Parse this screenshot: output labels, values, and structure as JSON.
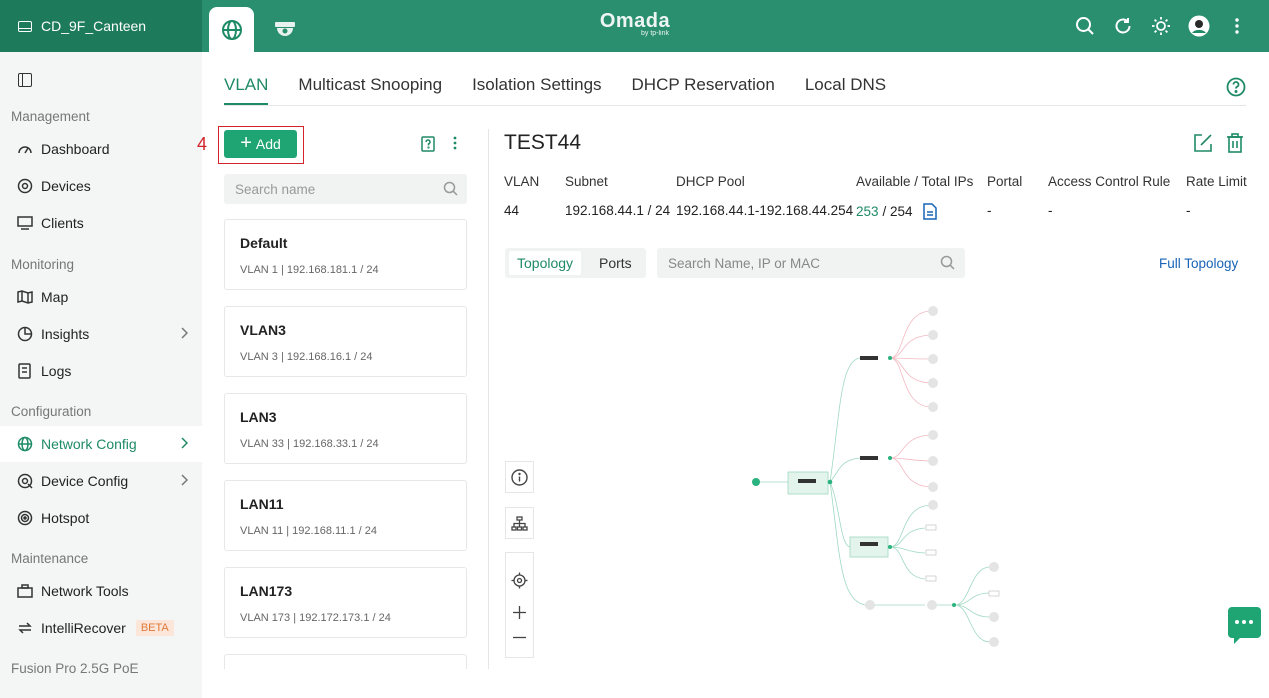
{
  "topbar": {
    "site_name": "CD_9F_Canteen",
    "logo": "Omada",
    "logo_sub": "by tp-link",
    "icons": [
      "search-icon",
      "refresh-icon",
      "theme-icon",
      "avatar",
      "more-icon"
    ]
  },
  "sidebar": {
    "sections": {
      "management": "Management",
      "monitoring": "Monitoring",
      "configuration": "Configuration",
      "maintenance": "Maintenance",
      "device_group": "Fusion Pro 2.5G PoE"
    },
    "items": {
      "dashboard": "Dashboard",
      "devices": "Devices",
      "clients": "Clients",
      "map": "Map",
      "insights": "Insights",
      "logs": "Logs",
      "network_config": "Network Config",
      "device_config": "Device Config",
      "hotspot": "Hotspot",
      "network_tools": "Network Tools",
      "intellirecover": "IntelliRecover",
      "beta": "BETA"
    }
  },
  "tabs": [
    "VLAN",
    "Multicast Snooping",
    "Isolation Settings",
    "DHCP Reservation",
    "Local DNS"
  ],
  "list": {
    "annotation": "4",
    "add_label": "Add",
    "search_placeholder": "Search name",
    "vlans": [
      {
        "name": "Default",
        "sub": "VLAN 1  |  192.168.181.1 / 24"
      },
      {
        "name": "VLAN3",
        "sub": "VLAN 3  |  192.168.16.1 / 24"
      },
      {
        "name": "LAN3",
        "sub": "VLAN 33  |  192.168.33.1 / 24"
      },
      {
        "name": "LAN11",
        "sub": "VLAN 11  |  192.168.11.1 / 24"
      },
      {
        "name": "LAN173",
        "sub": "VLAN 173  |  192.172.173.1 / 24"
      }
    ]
  },
  "detail": {
    "title": "TEST44",
    "headers": {
      "vlan": "VLAN",
      "subnet": "Subnet",
      "dhcp_pool": "DHCP Pool",
      "available": "Available / Total IPs",
      "portal": "Portal",
      "acl": "Access Control Rule",
      "rate": "Rate Limit"
    },
    "values": {
      "vlan": "44",
      "subnet": "192.168.44.1 / 24",
      "dhcp_pool": "192.168.44.1-192.168.44.254",
      "available": "253",
      "total": "/ 254",
      "portal": "-",
      "acl": "-",
      "rate": "-"
    },
    "segment": {
      "topology": "Topology",
      "ports": "Ports"
    },
    "topo_search_placeholder": "Search Name, IP or MAC",
    "full_topology": "Full Topology"
  },
  "colors": {
    "accent": "#1f8a66",
    "header": "#2a8f6e",
    "button": "#1fa574",
    "link": "#1763b6",
    "annotation": "#d2242a"
  }
}
